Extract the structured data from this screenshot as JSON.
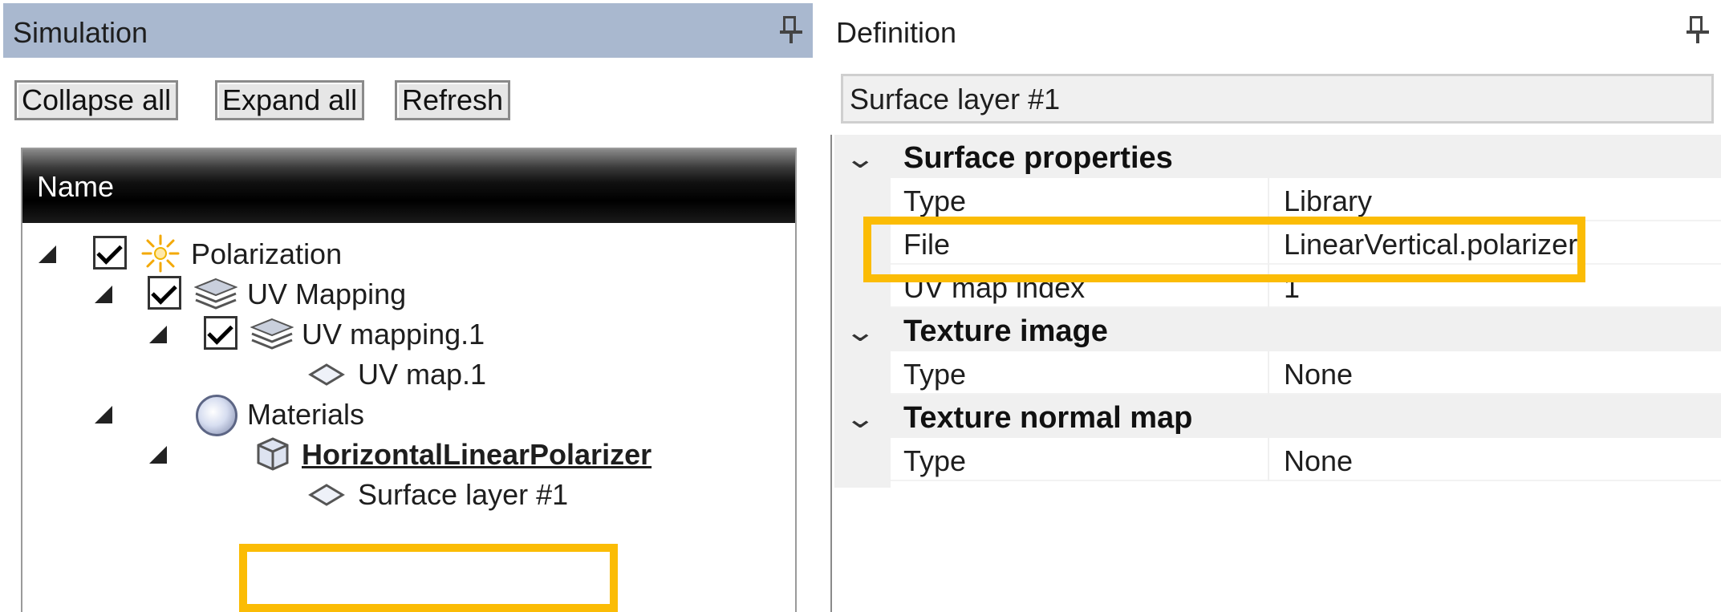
{
  "simulation_panel": {
    "title": "Simulation",
    "buttons": {
      "collapse_all": "Collapse all",
      "expand_all": "Expand all",
      "refresh": "Refresh"
    },
    "tree": {
      "column_header": "Name",
      "items": [
        {
          "label": "Polarization",
          "icon": "light-source-icon",
          "checked": true,
          "expanded": true
        },
        {
          "label": "UV Mapping",
          "icon": "layers-icon",
          "checked": true,
          "expanded": true
        },
        {
          "label": "UV mapping.1",
          "icon": "layers-icon",
          "checked": true,
          "expanded": true
        },
        {
          "label": "UV map.1",
          "icon": "diamond-icon"
        },
        {
          "label": "Materials",
          "icon": "sphere-icon",
          "expanded": true
        },
        {
          "label": "HorizontalLinearPolarizer",
          "icon": "cube-icon",
          "expanded": true,
          "bold_underlined": true
        },
        {
          "label": "Surface layer #1",
          "icon": "diamond-icon",
          "highlighted": true
        }
      ]
    }
  },
  "definition_panel": {
    "title": "Definition",
    "selected_item": "Surface layer #1",
    "categories": [
      {
        "name": "Surface properties",
        "properties": [
          {
            "name": "Type",
            "value": "Library"
          },
          {
            "name": "File",
            "value": "LinearVertical.polarizer",
            "highlighted": true
          },
          {
            "name": "UV map index",
            "value": "1"
          }
        ]
      },
      {
        "name": "Texture image",
        "properties": [
          {
            "name": "Type",
            "value": "None"
          }
        ]
      },
      {
        "name": "Texture normal map",
        "properties": [
          {
            "name": "Type",
            "value": "None"
          }
        ]
      }
    ]
  },
  "colors": {
    "highlight": "#fbbc05",
    "active_header": "#a9b8cf",
    "category_bg": "#f0f0f0"
  }
}
